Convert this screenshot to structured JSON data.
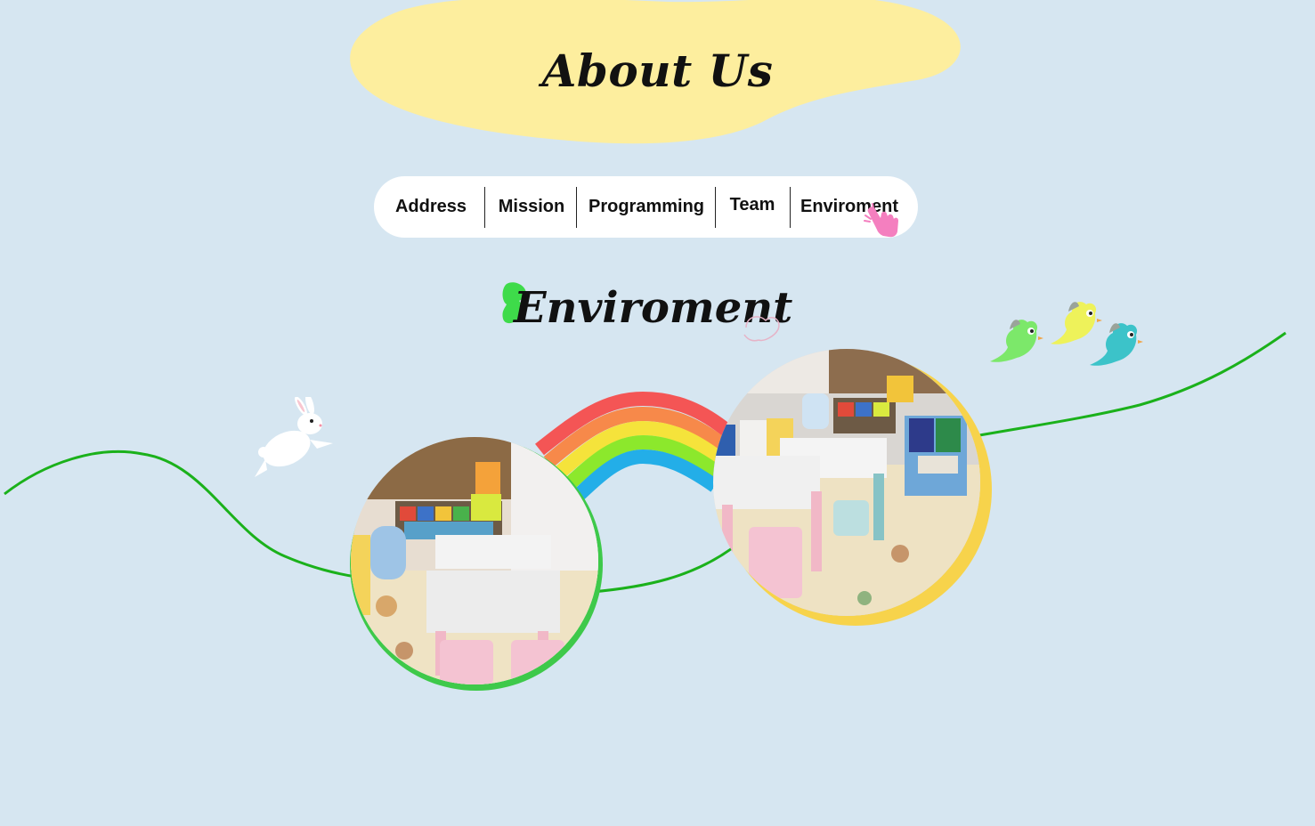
{
  "header": {
    "title": "About Us",
    "blob_color": "#fdee9e"
  },
  "nav": {
    "items": [
      {
        "label": "Address"
      },
      {
        "label": "Mission"
      },
      {
        "label": "Programming"
      },
      {
        "label": "Team"
      },
      {
        "label": "Enviroment"
      }
    ],
    "active": "Enviroment",
    "pointer_icon": "hand-pointer-icon",
    "pointer_color": "#f47fbf"
  },
  "section": {
    "title": "Enviroment",
    "accent_icon": "green-blob-icon",
    "accent_color": "#3edb4a"
  },
  "decorations": {
    "curve_color": "#1bb11b",
    "rainbow_colors": [
      "#f45555",
      "#f7894a",
      "#f5e33b",
      "#8ce82c",
      "#23aee8"
    ],
    "photo_left_ring": "#3ec94a",
    "photo_right_ring": "#f7d34b",
    "bird_colors": [
      "#7ce86a",
      "#eef25a",
      "#3cc3c9"
    ],
    "rabbit": "rabbit-icon"
  }
}
